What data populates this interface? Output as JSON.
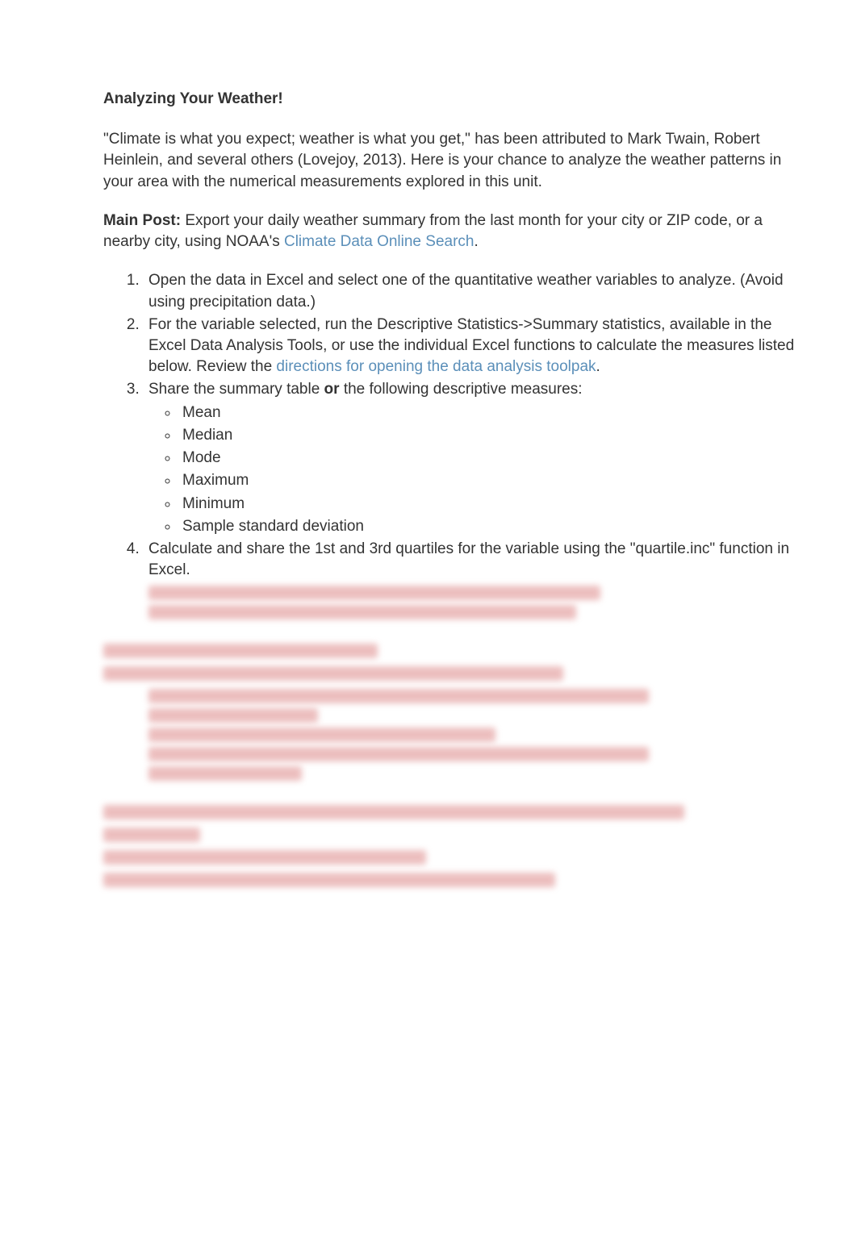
{
  "title": "Analyzing Your Weather!",
  "intro": "\"Climate is what you expect; weather is what you get,\" has been attributed to Mark Twain, Robert Heinlein, and several others (Lovejoy, 2013). Here is your chance to analyze the weather patterns in your area with the numerical measurements explored in this unit.",
  "main_post_label": "Main Post:",
  "main_post_text_1": " Export your daily weather summary from the last month for your city or ZIP code, or a nearby city, using NOAA's ",
  "main_post_link": "Climate Data Online Search",
  "main_post_text_2": ".",
  "steps": [
    "Open the data in Excel and select one of the quantitative weather variables to analyze. (Avoid using precipitation data.)",
    "For the variable selected, run the Descriptive Statistics->Summary statistics, available in the Excel Data Analysis Tools, or use the individual Excel functions to calculate the measures listed below. Review the ",
    "Share the summary table ",
    "Calculate and share the 1st and 3rd quartiles for the variable using the \"quartile.inc\" function in Excel."
  ],
  "step2_link": "directions for opening the data analysis toolpak",
  "step2_tail": ".",
  "step3_or": "or",
  "step3_tail": " the following descriptive measures:",
  "measures": [
    "Mean",
    "Median",
    "Mode",
    "Maximum",
    "Minimum",
    "Sample standard deviation"
  ]
}
